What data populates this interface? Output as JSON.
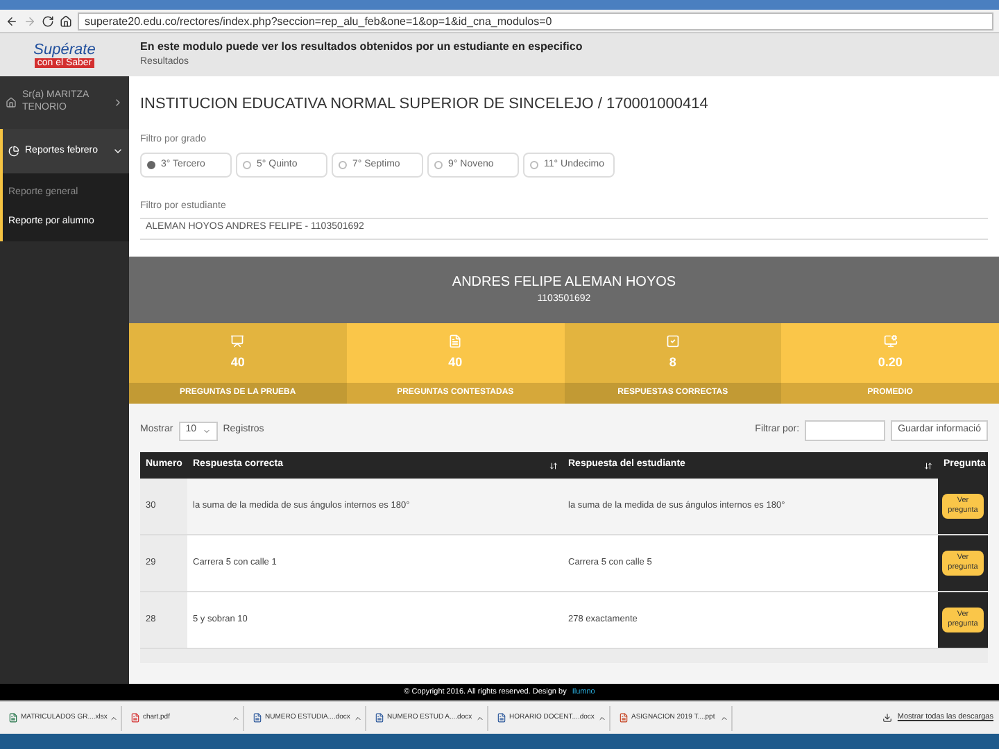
{
  "browser": {
    "url": "superate20.edu.co/rectores/index.php?seccion=rep_alu_feb&one=1&op=1&id_cna_modulos=0"
  },
  "header": {
    "logo_title": "Supérate",
    "logo_subtitle": "con el Saber",
    "title": "En este modulo puede ver los resultados obtenidos por un estudiante en especifico",
    "subtitle": "Resultados"
  },
  "sidebar": {
    "user": "Sr(a) MARITZA TENORIO",
    "section": {
      "label": "Reportes febrero",
      "expanded": true
    },
    "items": [
      {
        "label": "Reporte general",
        "selected": false
      },
      {
        "label": "Reporte por alumno",
        "selected": true
      }
    ]
  },
  "main": {
    "institution": "INSTITUCION EDUCATIVA NORMAL SUPERIOR DE SINCELEJO / 170001000414",
    "grade_filter": {
      "label": "Filtro por grado",
      "options": [
        {
          "label": "3° Tercero",
          "selected": true
        },
        {
          "label": "5° Quinto",
          "selected": false
        },
        {
          "label": "7° Septimo",
          "selected": false
        },
        {
          "label": "9° Noveno",
          "selected": false
        },
        {
          "label": "11° Undecimo",
          "selected": false
        }
      ]
    },
    "student_filter": {
      "label": "Filtro por estudiante",
      "value": "ALEMAN HOYOS ANDRES FELIPE - 1103501692"
    }
  },
  "student": {
    "name": "ANDRES FELIPE ALEMAN HOYOS",
    "id": "1103501692"
  },
  "stats": [
    {
      "kind": "test",
      "value": "40",
      "label": "PREGUNTAS DE LA PRUEBA"
    },
    {
      "kind": "answered",
      "value": "40",
      "label": "PREGUNTAS CONTESTADAS"
    },
    {
      "kind": "correct",
      "value": "8",
      "label": "RESPUESTAS CORRECTAS"
    },
    {
      "kind": "average",
      "value": "0.20",
      "label": "PROMEDIO"
    }
  ],
  "table_controls": {
    "show_label": "Mostrar",
    "page_size": "10",
    "records_label": "Registros",
    "filter_label": "Filtrar por:",
    "save_button": "Guardar informació"
  },
  "table": {
    "columns": [
      "Numero",
      "Respuesta correcta",
      "Respuesta del estudiante",
      "Pregunta"
    ],
    "rows": [
      {
        "number": "30",
        "correct": "la suma de la medida de sus ángulos internos es 180°",
        "student": "la suma de la medida de sus ángulos internos es 180°",
        "action": "Ver pregunta"
      },
      {
        "number": "29",
        "correct": "Carrera 5 con calle 1",
        "student": "Carrera 5 con calle 5",
        "action": "Ver pregunta"
      },
      {
        "number": "28",
        "correct": "5 y sobran 10",
        "student": "278 exactamente",
        "action": "Ver pregunta"
      }
    ]
  },
  "footer": {
    "text": "© Copyright 2016. All rights reserved. Design by",
    "link": "Ilumno"
  },
  "downloads": {
    "items": [
      {
        "kind": "excel",
        "name": "MATRICULADOS GR....xlsx"
      },
      {
        "kind": "pdf",
        "name": "chart.pdf"
      },
      {
        "kind": "word",
        "name": "NUMERO ESTUDIA....docx"
      },
      {
        "kind": "word",
        "name": "NUMERO ESTUD A....docx"
      },
      {
        "kind": "word",
        "name": "HORARIO DOCENT....docx"
      },
      {
        "kind": "ppt",
        "name": "ASIGNACION 2019 T....ppt"
      }
    ],
    "show_all": "Mostrar todas las descargas"
  }
}
